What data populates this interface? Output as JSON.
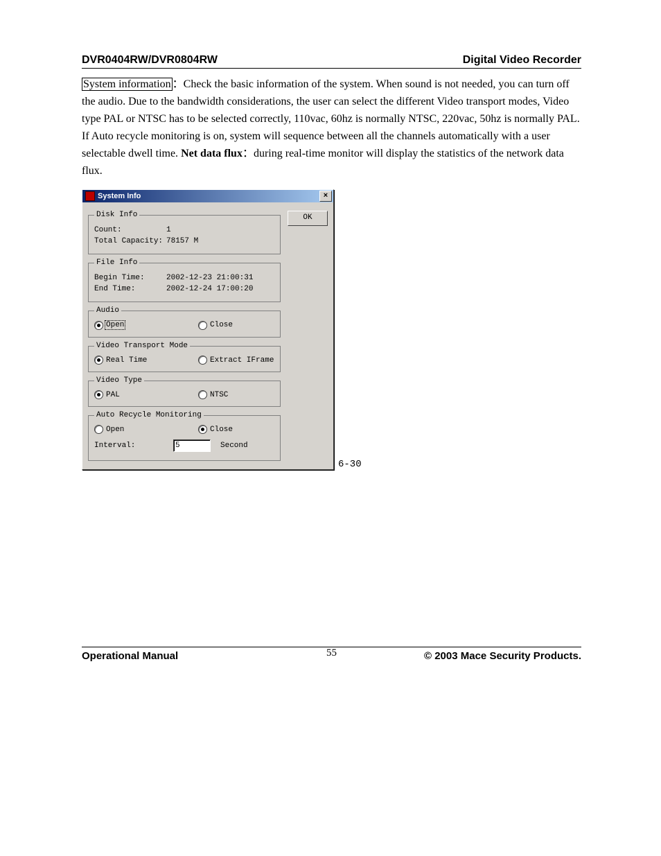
{
  "header": {
    "left": "DVR0404RW/DVR0804RW",
    "right": "Digital Video Recorder"
  },
  "body": {
    "sys_info_label": "System information",
    "colon1": "：",
    "text_a": "Check the basic information of the system. When sound is not needed, you can turn off the audio. Due to the bandwidth considerations, the user can select the different Video transport modes, Video type PAL or NTSC has to be selected correctly, 110vac, 60hz is normally NTSC, 220vac, 50hz is normally PAL. If Auto recycle monitoring is on, system will sequence between all the channels automatically with a user selectable dwell time. ",
    "net_label": "Net data flux",
    "colon2": "：",
    "text_b": "during real-time monitor will display the statistics of the network data flux."
  },
  "dialog": {
    "title": "System Info",
    "close_glyph": "×",
    "ok_label": "OK",
    "disk": {
      "legend": "Disk Info",
      "count_label": "Count:",
      "count_value": "1",
      "capacity_label": "Total Capacity:",
      "capacity_value": "78157 M"
    },
    "file": {
      "legend": "File Info",
      "begin_label": "Begin Time:",
      "begin_value": "2002-12-23  21:00:31",
      "end_label": "End Time:",
      "end_value": "2002-12-24  17:00:20"
    },
    "audio": {
      "legend": "Audio",
      "open": "Open",
      "close": "Close"
    },
    "vtm": {
      "legend": "Video Transport Mode",
      "real": "Real Time",
      "extract": "Extract IFrame"
    },
    "vtype": {
      "legend": "Video Type",
      "pal": "PAL",
      "ntsc": "NTSC"
    },
    "arm": {
      "legend": "Auto Recycle Monitoring",
      "open": "Open",
      "close": "Close",
      "interval_label": "Interval:",
      "interval_value": "5",
      "unit": "Second"
    }
  },
  "figure_caption": "6-30",
  "footer": {
    "left": "Operational Manual",
    "page": "55",
    "right": "© 2003 Mace Security Products."
  }
}
